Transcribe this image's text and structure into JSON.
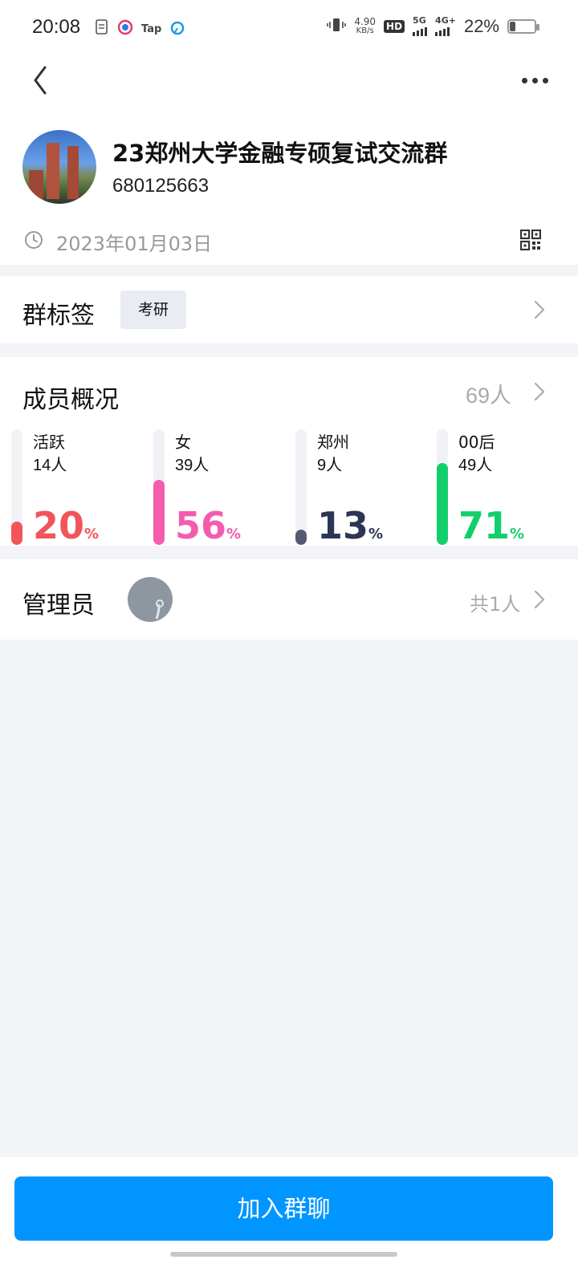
{
  "status_bar": {
    "time": "20:08",
    "net_speed_value": "4.90",
    "net_speed_unit": "KB/s",
    "hd": "HD",
    "sim1": "5G",
    "sim2": "4G+",
    "battery": "22%",
    "battery_level": 0.22,
    "app_icons": [
      "file-icon",
      "qq-browser-icon",
      "tap-icon",
      "bilibili-icon"
    ],
    "tap_label": "Tap"
  },
  "nav": {
    "back_icon": "chevron-left-icon",
    "more_icon": "more-dots-icon"
  },
  "group": {
    "name": "23郑州大学金融专硕复试交流群",
    "id": "680125663",
    "created_date": "2023年01月03日"
  },
  "tags": {
    "label": "群标签",
    "items": [
      "考研"
    ]
  },
  "members": {
    "label": "成员概况",
    "count": "69人",
    "stats": [
      {
        "name": "活跃",
        "count": "14人",
        "value": "20",
        "percent": 20,
        "color": "#f2545b"
      },
      {
        "name": "女",
        "count": "39人",
        "value": "56",
        "percent": 56,
        "color": "#f45cae"
      },
      {
        "name": "郑州",
        "count": "9人",
        "value": "13",
        "percent": 13,
        "color": "#2c3554"
      },
      {
        "name": "00后",
        "count": "49人",
        "value": "71",
        "percent": 71,
        "color": "#12cf6c"
      }
    ],
    "pct_sign": "%"
  },
  "admin": {
    "label": "管理员",
    "total": "共1人"
  },
  "join_button": "加入群聊",
  "colors": {
    "accent": "#0196ff",
    "background": "#f3f4f8"
  }
}
